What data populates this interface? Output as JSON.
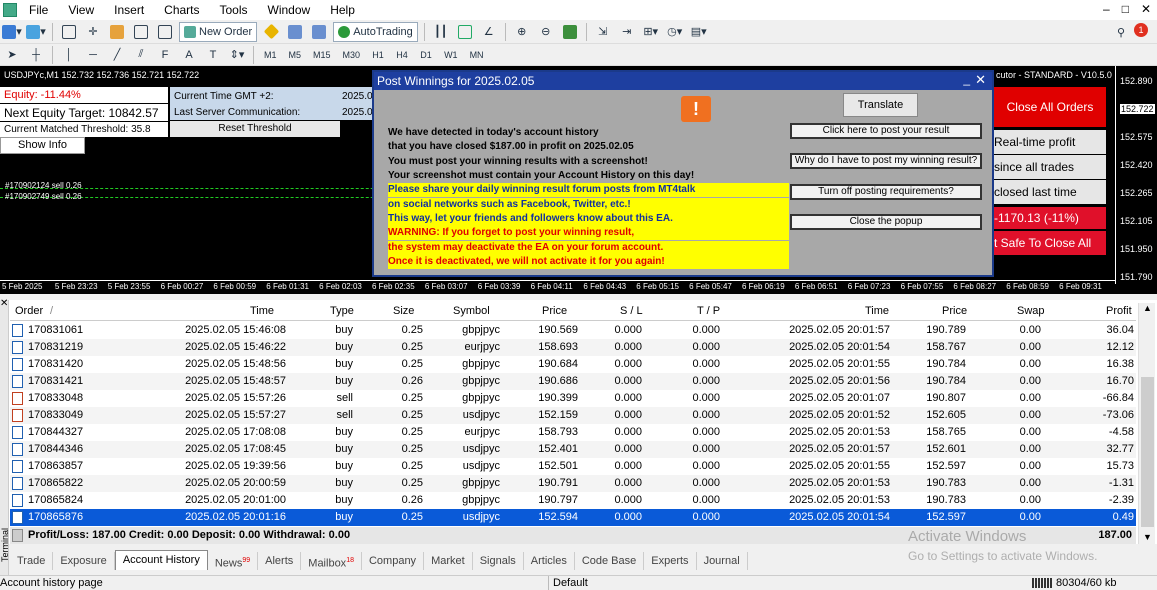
{
  "menubar": {
    "items": [
      "File",
      "View",
      "Insert",
      "Charts",
      "Tools",
      "Window",
      "Help"
    ],
    "win_controls": [
      "–",
      "□",
      "✕"
    ]
  },
  "toolbar1": {
    "new_order": "New Order",
    "autotrading": "AutoTrading"
  },
  "toolbar2": {
    "timeframes": [
      "M1",
      "M5",
      "M15",
      "M30",
      "H1",
      "H4",
      "D1",
      "W1",
      "MN"
    ]
  },
  "chart": {
    "title": "USDJPYc,M1  152.732 152.736 152.721 152.722",
    "price_labels": [
      "152.890",
      "152.722",
      "152.575",
      "152.420",
      "152.265",
      "152.105",
      "151.950",
      "151.790"
    ],
    "time_labels": [
      "5 Feb 2025",
      "5 Feb 23:23",
      "5 Feb 23:55",
      "6 Feb 00:27",
      "6 Feb 00:59",
      "6 Feb 01:31",
      "6 Feb 02:03",
      "6 Feb 02:35",
      "6 Feb 03:07",
      "6 Feb 03:39",
      "6 Feb 04:11",
      "6 Feb 04:43",
      "6 Feb 05:15",
      "6 Feb 05:47",
      "6 Feb 06:19",
      "6 Feb 06:51",
      "6 Feb 07:23",
      "6 Feb 07:55",
      "6 Feb 08:27",
      "6 Feb 08:59",
      "6 Feb 09:31"
    ],
    "sell_lines": [
      "#170902124 sell 0.26",
      "#170902749 sell 0.26"
    ]
  },
  "equity_panel": {
    "equity": "Equity: -11.44%",
    "next_target": "Next Equity Target: 10842.57",
    "matched_threshold": "Current Matched Threshold: 35.8",
    "show_info": "Show Info",
    "gmt": "Current Time GMT +2:",
    "last_comm": "Last Server Communication:",
    "reset": "Reset Threshold",
    "srv1": "2025.0",
    "srv2": "2025.0"
  },
  "ea_panel": {
    "title": "cutor - STANDARD - V10.5.0",
    "close_all": "Close All Orders",
    "realtime": "Real-time profit",
    "since_all": "since all trades",
    "closed_last": "closed last time",
    "loss": "-1170.13 (-11%)",
    "safe": "t Safe To Close All"
  },
  "popup": {
    "title": "Post Winnings for 2025.02.05",
    "min": "_",
    "close": "✕",
    "warn": "!",
    "lines": [
      "We have detected in today's account history",
      "that you have closed $187.00 in profit on 2025.02.05",
      "You must post your winning results with a screenshot!",
      "Your screenshot must contain your Account History on this day!"
    ],
    "yellow_blue": [
      "Please share your daily winning result forum posts from MT4talk",
      "on social networks such as Facebook, Twitter, etc.!",
      "This way, let your friends and followers know about this EA."
    ],
    "yellow_red": [
      "WARNING: If you forget to post your winning result,",
      "the system may deactivate the EA on your forum account.",
      "Once it is deactivated, we will not activate it for you again!"
    ],
    "translate": "Translate",
    "btn_post": "Click here to post your result",
    "btn_why": "Why do I have to post my winning result?",
    "btn_turnoff": "Turn off posting requirements?",
    "btn_close": "Close the popup"
  },
  "table": {
    "headers": [
      "Order",
      "/",
      "Time",
      "Type",
      "Size",
      "Symbol",
      "Price",
      "S / L",
      "T / P",
      "Time",
      "Price",
      "Swap",
      "Profit"
    ],
    "rows": [
      [
        "170831061",
        "2025.02.05 15:46:08",
        "buy",
        "0.25",
        "gbpjpyc",
        "190.569",
        "0.000",
        "0.000",
        "2025.02.05 20:01:57",
        "190.789",
        "0.00",
        "36.04"
      ],
      [
        "170831219",
        "2025.02.05 15:46:22",
        "buy",
        "0.25",
        "eurjpyc",
        "158.693",
        "0.000",
        "0.000",
        "2025.02.05 20:01:54",
        "158.767",
        "0.00",
        "12.12"
      ],
      [
        "170831420",
        "2025.02.05 15:48:56",
        "buy",
        "0.25",
        "gbpjpyc",
        "190.684",
        "0.000",
        "0.000",
        "2025.02.05 20:01:55",
        "190.784",
        "0.00",
        "16.38"
      ],
      [
        "170831421",
        "2025.02.05 15:48:57",
        "buy",
        "0.26",
        "gbpjpyc",
        "190.686",
        "0.000",
        "0.000",
        "2025.02.05 20:01:56",
        "190.784",
        "0.00",
        "16.70"
      ],
      [
        "170833048",
        "2025.02.05 15:57:26",
        "sell",
        "0.25",
        "gbpjpyc",
        "190.399",
        "0.000",
        "0.000",
        "2025.02.05 20:01:07",
        "190.807",
        "0.00",
        "-66.84"
      ],
      [
        "170833049",
        "2025.02.05 15:57:27",
        "sell",
        "0.25",
        "usdjpyc",
        "152.159",
        "0.000",
        "0.000",
        "2025.02.05 20:01:52",
        "152.605",
        "0.00",
        "-73.06"
      ],
      [
        "170844327",
        "2025.02.05 17:08:08",
        "buy",
        "0.25",
        "eurjpyc",
        "158.793",
        "0.000",
        "0.000",
        "2025.02.05 20:01:53",
        "158.765",
        "0.00",
        "-4.58"
      ],
      [
        "170844346",
        "2025.02.05 17:08:45",
        "buy",
        "0.25",
        "usdjpyc",
        "152.401",
        "0.000",
        "0.000",
        "2025.02.05 20:01:57",
        "152.601",
        "0.00",
        "32.77"
      ],
      [
        "170863857",
        "2025.02.05 19:39:56",
        "buy",
        "0.25",
        "usdjpyc",
        "152.501",
        "0.000",
        "0.000",
        "2025.02.05 20:01:55",
        "152.597",
        "0.00",
        "15.73"
      ],
      [
        "170865822",
        "2025.02.05 20:00:59",
        "buy",
        "0.25",
        "gbpjpyc",
        "190.791",
        "0.000",
        "0.000",
        "2025.02.05 20:01:53",
        "190.783",
        "0.00",
        "-1.31"
      ],
      [
        "170865824",
        "2025.02.05 20:01:00",
        "buy",
        "0.26",
        "gbpjpyc",
        "190.797",
        "0.000",
        "0.000",
        "2025.02.05 20:01:53",
        "190.783",
        "0.00",
        "-2.39"
      ],
      [
        "170865876",
        "2025.02.05 20:01:16",
        "buy",
        "0.25",
        "usdjpyc",
        "152.594",
        "0.000",
        "0.000",
        "2025.02.05 20:01:54",
        "152.597",
        "0.00",
        "0.49"
      ]
    ],
    "totals": "Profit/Loss: 187.00  Credit: 0.00  Deposit: 0.00  Withdrawal: 0.00",
    "total_profit": "187.00"
  },
  "tabs": [
    {
      "label": "Trade",
      "badge": ""
    },
    {
      "label": "Exposure",
      "badge": ""
    },
    {
      "label": "Account History",
      "badge": ""
    },
    {
      "label": "News",
      "badge": "99"
    },
    {
      "label": "Alerts",
      "badge": ""
    },
    {
      "label": "Mailbox",
      "badge": "18"
    },
    {
      "label": "Company",
      "badge": ""
    },
    {
      "label": "Market",
      "badge": ""
    },
    {
      "label": "Signals",
      "badge": ""
    },
    {
      "label": "Articles",
      "badge": ""
    },
    {
      "label": "Code Base",
      "badge": ""
    },
    {
      "label": "Experts",
      "badge": ""
    },
    {
      "label": "Journal",
      "badge": ""
    }
  ],
  "terminal_side": {
    "close": "✕",
    "label": "Terminal"
  },
  "statusbar": {
    "left": "Account history page",
    "profile": "Default",
    "traffic": "80304/60 kb"
  },
  "watermark": {
    "line1": "Activate Windows",
    "line2": "Go to Settings to activate Windows."
  }
}
